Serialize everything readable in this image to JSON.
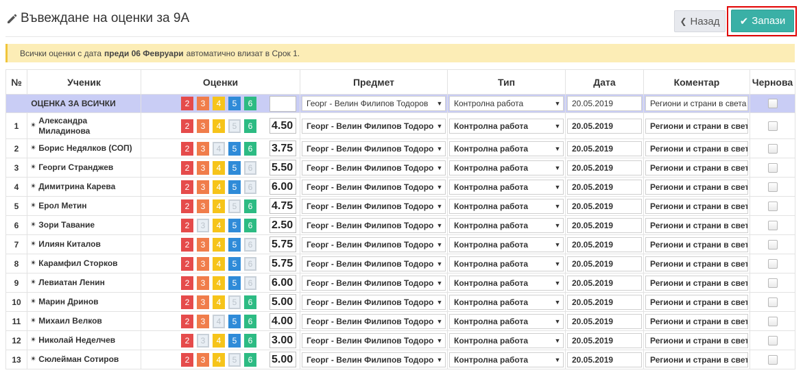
{
  "header": {
    "title": "Въвеждане на оценки за 9А",
    "back_label": "Назад",
    "save_label": "Запази"
  },
  "notice": {
    "before": "Всички оценки с дата",
    "bold": "преди 06 Февруари",
    "after": "автоматично влизат в Срок 1."
  },
  "table": {
    "headers": [
      "№",
      "Ученик",
      "Оценки",
      "Предмет",
      "Тип",
      "Дата",
      "Коментар",
      "Чернова"
    ],
    "grade_options": [
      "2",
      "3",
      "4",
      "5",
      "6"
    ],
    "all_row": {
      "label": "ОЦЕНКА ЗА ВСИЧКИ",
      "subject": "Георг - Велин Филипов Тодоров",
      "type": "Контролна работа",
      "date": "20.05.2019",
      "comment": "Региони и страни в света"
    },
    "rows": [
      {
        "num": "1",
        "name": "Александра Миладинова",
        "selected": "5",
        "avg": "4.50",
        "subject": "Георг - Велин Филипов Тодоров",
        "type": "Контролна работа",
        "date": "20.05.2019",
        "comment": "Региони и страни в света"
      },
      {
        "num": "2",
        "name": "Борис Недялков (СОП)",
        "selected": "4",
        "avg": "3.75",
        "subject": "Георг - Велин Филипов Тодоров",
        "type": "Контролна работа",
        "date": "20.05.2019",
        "comment": "Региони и страни в света"
      },
      {
        "num": "3",
        "name": "Георги Странджев",
        "selected": "6",
        "avg": "5.50",
        "subject": "Георг - Велин Филипов Тодоров",
        "type": "Контролна работа",
        "date": "20.05.2019",
        "comment": "Региони и страни в света"
      },
      {
        "num": "4",
        "name": "Димитрина Карева",
        "selected": "6",
        "avg": "6.00",
        "subject": "Георг - Велин Филипов Тодоров",
        "type": "Контролна работа",
        "date": "20.05.2019",
        "comment": "Региони и страни в света"
      },
      {
        "num": "5",
        "name": "Ерол Метин",
        "selected": "5",
        "avg": "4.75",
        "subject": "Георг - Велин Филипов Тодоров",
        "type": "Контролна работа",
        "date": "20.05.2019",
        "comment": "Региони и страни в света"
      },
      {
        "num": "6",
        "name": "Зори Тавание",
        "selected": "3",
        "avg": "2.50",
        "subject": "Георг - Велин Филипов Тодоров",
        "type": "Контролна работа",
        "date": "20.05.2019",
        "comment": "Региони и страни в света"
      },
      {
        "num": "7",
        "name": "Илиян Киталов",
        "selected": "6",
        "avg": "5.75",
        "subject": "Георг - Велин Филипов Тодоров",
        "type": "Контролна работа",
        "date": "20.05.2019",
        "comment": "Региони и страни в света"
      },
      {
        "num": "8",
        "name": "Карамфил Сторков",
        "selected": "6",
        "avg": "5.75",
        "subject": "Георг - Велин Филипов Тодоров",
        "type": "Контролна работа",
        "date": "20.05.2019",
        "comment": "Региони и страни в света"
      },
      {
        "num": "9",
        "name": "Левиатан Ленин",
        "selected": "6",
        "avg": "6.00",
        "subject": "Георг - Велин Филипов Тодоров",
        "type": "Контролна работа",
        "date": "20.05.2019",
        "comment": "Региони и страни в света"
      },
      {
        "num": "10",
        "name": "Марин Дринов",
        "selected": "5",
        "avg": "5.00",
        "subject": "Георг - Велин Филипов Тодоров",
        "type": "Контролна работа",
        "date": "20.05.2019",
        "comment": "Региони и страни в света"
      },
      {
        "num": "11",
        "name": "Михаил Велков",
        "selected": "4",
        "avg": "4.00",
        "subject": "Георг - Велин Филипов Тодоров",
        "type": "Контролна работа",
        "date": "20.05.2019",
        "comment": "Региони и страни в света"
      },
      {
        "num": "12",
        "name": "Николай Неделчев",
        "selected": "3",
        "avg": "3.00",
        "subject": "Георг - Велин Филипов Тодоров",
        "type": "Контролна работа",
        "date": "20.05.2019",
        "comment": "Региони и страни в света"
      },
      {
        "num": "13",
        "name": "Сюлейман Сотиров",
        "selected": "5",
        "avg": "5.00",
        "subject": "Георг - Велин Филипов Тодоров",
        "type": "Контролна работа",
        "date": "20.05.2019",
        "comment": "Региони и страни в света"
      }
    ]
  },
  "colors": {
    "save_button": "#3ab0a6",
    "highlight_frame": "#e10000",
    "notice_bg": "#fcedb6",
    "all_row_bg": "#c9cdf5",
    "grade_2": "#e54b4b",
    "grade_3": "#f07d4b",
    "grade_4": "#f6c41a",
    "grade_5": "#2f8bd8",
    "grade_6": "#2dbb83"
  },
  "icons": {
    "title": "pencil-icon",
    "back": "chevron-left-icon",
    "save": "check-icon",
    "student": "student-icon",
    "dropdown": "caret-down-icon"
  }
}
